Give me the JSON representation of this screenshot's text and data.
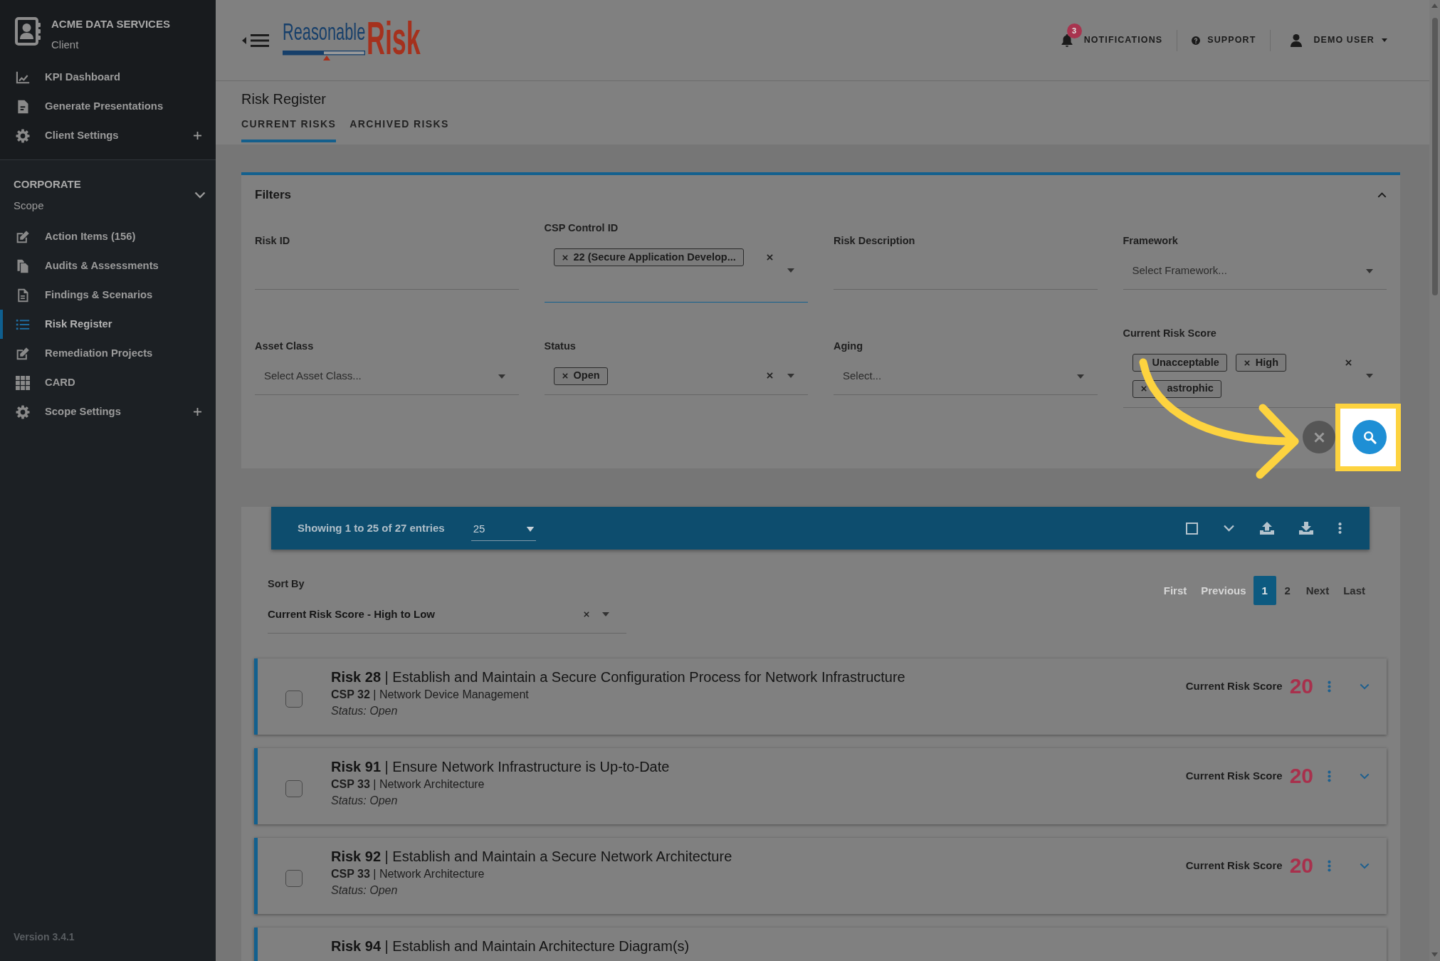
{
  "sidebar": {
    "client": {
      "name": "ACME DATA SERVICES",
      "role": "Client"
    },
    "client_items": [
      {
        "label": "KPI Dashboard",
        "expandable": false,
        "selected": false
      },
      {
        "label": "Generate Presentations",
        "expandable": false,
        "selected": false
      },
      {
        "label": "Client Settings",
        "expandable": true,
        "selected": false
      }
    ],
    "scope": {
      "name": "CORPORATE",
      "role": "Scope",
      "expanded": true
    },
    "scope_items": [
      {
        "label": "Action Items (156)",
        "expandable": false,
        "selected": false
      },
      {
        "label": "Audits & Assessments",
        "expandable": false,
        "selected": false
      },
      {
        "label": "Findings & Scenarios",
        "expandable": false,
        "selected": false
      },
      {
        "label": "Risk Register",
        "expandable": false,
        "selected": true
      },
      {
        "label": "Remediation Projects",
        "expandable": false,
        "selected": false
      },
      {
        "label": "CARD",
        "expandable": false,
        "selected": false
      },
      {
        "label": "Scope Settings",
        "expandable": true,
        "selected": false
      }
    ],
    "version": "Version 3.4.1"
  },
  "header": {
    "logo": {
      "first": "Reasonable",
      "second": "Risk"
    },
    "notifications": {
      "label": "NOTIFICATIONS",
      "count": "3"
    },
    "support": {
      "label": "SUPPORT"
    },
    "user": {
      "label": "DEMO USER"
    }
  },
  "page": {
    "title": "Risk Register",
    "tabs": [
      {
        "label": "CURRENT RISKS",
        "selected": true
      },
      {
        "label": "ARCHIVED RISKS",
        "selected": false
      }
    ]
  },
  "filters": {
    "title": "Filters",
    "expanded": true,
    "fields": [
      {
        "kind": "text",
        "label": "Risk ID",
        "focused": false
      },
      {
        "kind": "multi",
        "label": "CSP Control ID",
        "focused": true,
        "tags": [
          {
            "label": "22 (Secure Application Develop...",
            "remove_visible": true,
            "label_cut": false
          }
        ]
      },
      {
        "kind": "text",
        "label": "Risk Description",
        "focused": false
      },
      {
        "kind": "select",
        "label": "Framework",
        "placeholder": "Select Framework...",
        "focused": false
      },
      {
        "kind": "select",
        "label": "Asset Class",
        "placeholder": "Select Asset Class...",
        "focused": false
      },
      {
        "kind": "multi",
        "label": "Status",
        "focused": false,
        "tags": [
          {
            "label": "Open",
            "remove_visible": true,
            "label_cut": false
          }
        ]
      },
      {
        "kind": "select",
        "label": "Aging",
        "placeholder": "Select...",
        "focused": false
      },
      {
        "kind": "multi",
        "label": "Current Risk Score",
        "focused": false,
        "tags": [
          {
            "label": "Unacceptable",
            "remove_visible": false,
            "label_cut": false
          },
          {
            "label": "High",
            "remove_visible": true,
            "label_cut": false
          },
          {
            "label": "astrophic",
            "remove_visible": true,
            "label_cut": true
          }
        ]
      }
    ],
    "actions": [
      {
        "kind": "clear",
        "highlighted": false
      },
      {
        "kind": "search",
        "highlighted": true
      }
    ],
    "callout_arrow": true
  },
  "results": {
    "summary": "Showing 1 to 25 of 27 entries",
    "page_size": "25",
    "select_all_checked": false,
    "sort": {
      "label": "Sort By",
      "value": "Current Risk Score - High to Low"
    },
    "pages": [
      {
        "label": "First",
        "selected": false,
        "disabled": true
      },
      {
        "label": "Previous",
        "selected": false,
        "disabled": true
      },
      {
        "label": "1",
        "selected": true,
        "disabled": false
      },
      {
        "label": "2",
        "selected": false,
        "disabled": false
      },
      {
        "label": "Next",
        "selected": false,
        "disabled": false
      },
      {
        "label": "Last",
        "selected": false,
        "disabled": false
      }
    ],
    "risks": [
      {
        "title": "**Risk 28** | Establish and Maintain a Secure Configuration Process for Network Infrastructure",
        "control": "**CSP 32** | Network Device Management",
        "status": "Status: Open",
        "score_label": "Current Risk Score",
        "score": "20",
        "checked": false,
        "expanded": false
      },
      {
        "title": "**Risk 91** | Ensure Network Infrastructure is Up-to-Date",
        "control": "**CSP 33** | Network Architecture",
        "status": "Status: Open",
        "score_label": "Current Risk Score",
        "score": "20",
        "checked": false,
        "expanded": false
      },
      {
        "title": "**Risk 92** | Establish and Maintain a Secure Network Architecture",
        "control": "**CSP 33** | Network Architecture",
        "status": "Status: Open",
        "score_label": "Current Risk Score",
        "score": "20",
        "checked": false,
        "expanded": false
      },
      {
        "title": "**Risk 94** | Establish and Maintain Architecture Diagram(s)"
      }
    ]
  }
}
